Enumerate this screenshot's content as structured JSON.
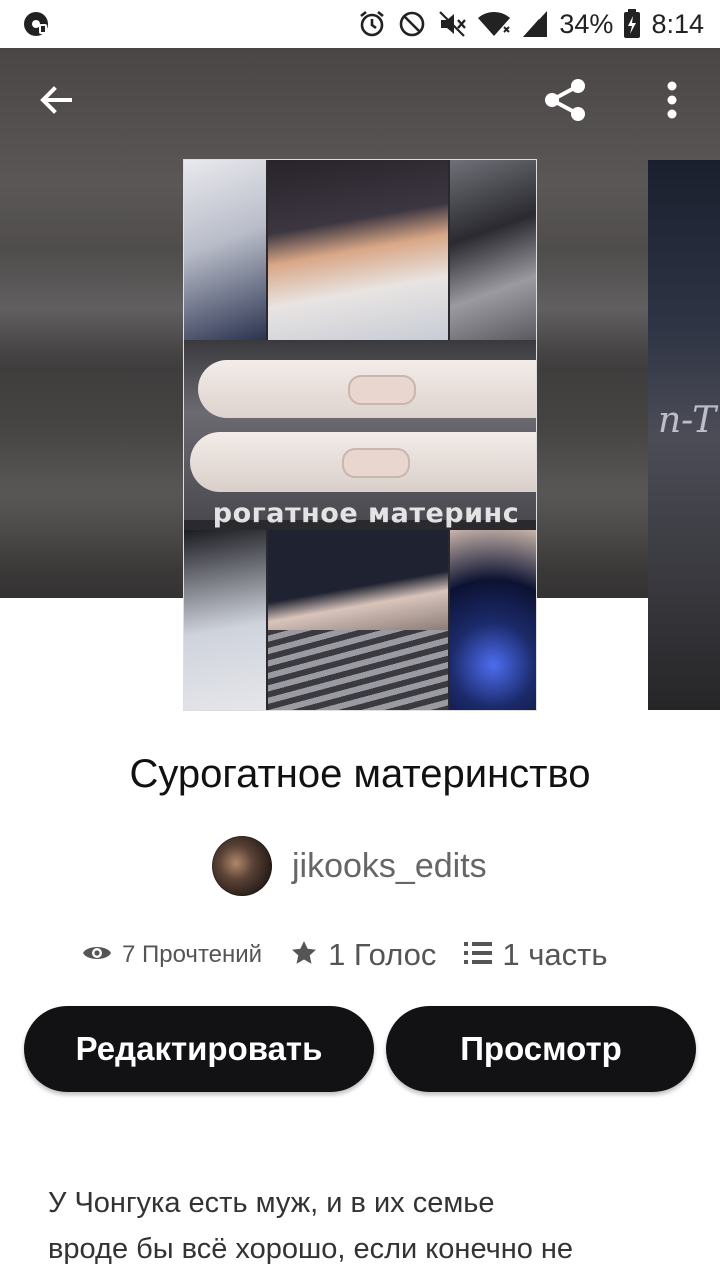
{
  "status_bar": {
    "battery_percent": "34%",
    "time": "8:14",
    "icons": [
      "music-app-icon",
      "alarm-icon",
      "do-not-disturb-icon",
      "mute-icon",
      "wifi-icon",
      "signal-icon",
      "battery-charging-icon"
    ]
  },
  "toolbar": {
    "back_icon": "arrow-back-icon",
    "share_icon": "share-icon",
    "more_icon": "more-vert-icon"
  },
  "cover": {
    "overlay_text": "рогатное материнс",
    "side_cover_text": "n-T"
  },
  "story": {
    "title": "Сурогатное материнство",
    "author": "jikooks_edits",
    "reads": "7 Прочтений",
    "votes": "1 Голос",
    "parts": "1 часть"
  },
  "buttons": {
    "edit": "Редактировать",
    "preview": "Просмотр"
  },
  "description": {
    "line1": "У Чонгука есть муж, и в их семье",
    "line2": "вроде бы всё хорошо, если конечно не"
  },
  "colors": {
    "button_bg": "#121214",
    "hero_bg": "#4a4646",
    "text_primary": "#111111",
    "text_secondary": "#666666"
  }
}
